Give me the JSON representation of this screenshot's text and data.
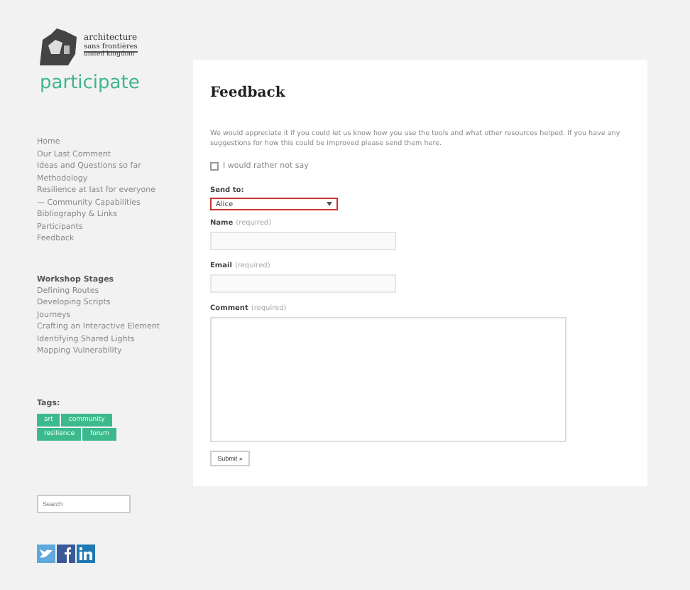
{
  "logo": {
    "line_1": "architecture",
    "line_2": "sans frontières",
    "line_3": "united kingdom",
    "tagline": "participate"
  },
  "nav": [
    {
      "label": "Home"
    },
    {
      "label": "Our Last Comment"
    },
    {
      "label": "Ideas and Questions so far"
    },
    {
      "label": "Methodology"
    },
    {
      "label": "Resilience at last for everyone"
    },
    {
      "label": "— Community Capabilities"
    },
    {
      "label": "Bibliography & Links"
    },
    {
      "label": "Participants"
    },
    {
      "label": "Feedback"
    }
  ],
  "stages": {
    "title": "Workshop Stages",
    "items": [
      "Defining Routes",
      "Developing Scripts",
      "Journeys",
      "Crafting an Interactive Element",
      "Identifying Shared Lights",
      "Mapping Vulnerability"
    ]
  },
  "tags": {
    "title": "Tags:",
    "items": [
      "art",
      "community",
      "resilience",
      "forum"
    ]
  },
  "search": {
    "placeholder": "Search"
  },
  "social": [
    {
      "kind": "twitter"
    },
    {
      "kind": "facebook"
    },
    {
      "kind": "linkedin"
    }
  ],
  "page": {
    "title": "Feedback",
    "intro": "We would appreciate it if you could let us know how you use the tools and what other resources helped. If you have any suggestions for how this could be improved please send them here.",
    "anonymous": {
      "label": "I would rather not say",
      "checked": false
    },
    "send_to": {
      "label": "Send to:",
      "value": "Alice"
    },
    "fields": [
      {
        "kind": "input",
        "label": "Name",
        "hint": "(required)"
      },
      {
        "kind": "input",
        "label": "Email",
        "hint": "(required)"
      },
      {
        "kind": "textarea",
        "label": "Comment",
        "hint": "(required)"
      }
    ],
    "submit": "Submit »"
  }
}
